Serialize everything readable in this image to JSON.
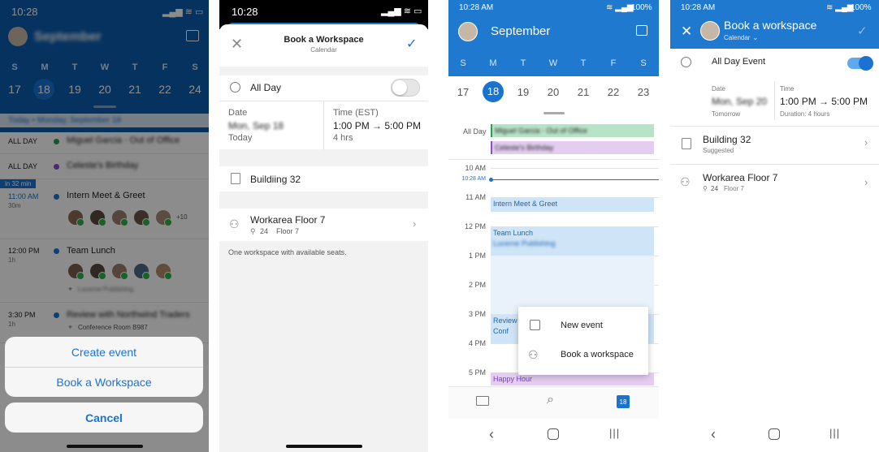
{
  "panel1": {
    "status_time": "10:28",
    "header_title": "September",
    "weekdays": [
      "S",
      "M",
      "T",
      "W",
      "T",
      "F",
      "S"
    ],
    "dates": [
      "17",
      "18",
      "19",
      "20",
      "21",
      "22",
      "24"
    ],
    "selected_date": "18",
    "today_strip": "Today • Monday, September 18",
    "events": [
      {
        "time": "ALL DAY",
        "title": "Miguel Garcia - Out of Office",
        "color": "#2e9b52"
      },
      {
        "time": "ALL DAY",
        "title": "Celeste's Birthday",
        "color": "#8a4fc2"
      },
      {
        "badge": "in 32 min",
        "time": "11:00 AM",
        "sub": "30m",
        "title": "Intern Meet & Greet",
        "color": "#1873d3",
        "more": "+10"
      },
      {
        "time": "12:00 PM",
        "sub": "1h",
        "title": "Team Lunch",
        "location": "Lucerne Publishing",
        "color": "#1873d3"
      },
      {
        "time": "3:30 PM",
        "sub": "1h",
        "title": "Review with Northwind Traders",
        "location": "Conference Room B987",
        "color": "#1873d3"
      }
    ],
    "sheet": {
      "create_event": "Create event",
      "book_workspace": "Book a Workspace",
      "cancel": "Cancel"
    }
  },
  "panel2": {
    "status_time": "10:28",
    "title": "Book a Workspace",
    "subtitle": "Calendar",
    "all_day_label": "All Day",
    "date_label": "Date",
    "date_value": "Mon, Sep 18",
    "date_sub": "Today",
    "time_label": "Time (EST)",
    "time_value": "1:00 PM → 5:00 PM",
    "time_sub": "4 hrs",
    "building": "Buildiing 32",
    "workarea": "Workarea Floor 7",
    "seats": "24",
    "floor": "Floor 7",
    "note": "One workspace with available seats."
  },
  "panel3": {
    "status_time": "10:28 AM",
    "battery": "100%",
    "month": "September",
    "weekdays": [
      "S",
      "M",
      "T",
      "W",
      "T",
      "F",
      "S"
    ],
    "dates": [
      "17",
      "18",
      "19",
      "20",
      "21",
      "22",
      "23"
    ],
    "selected_date": "18",
    "all_day_label": "All Day",
    "allday_events": [
      {
        "title": "Miguel Garcia - Out of Office",
        "color": "#b9e3c6"
      },
      {
        "title": "Celeste's Birthday",
        "color": "#e3cdf1"
      }
    ],
    "hours": [
      "10 AM",
      "11 AM",
      "12 PM",
      "1 PM",
      "2 PM",
      "3 PM",
      "4 PM",
      "5 PM"
    ],
    "now_label": "10:28 AM",
    "events": [
      {
        "title": "Intern Meet & Greet"
      },
      {
        "title": "Team Lunch",
        "location": "Lucerne Publishing"
      },
      {
        "title": "Review w",
        "location": "Conf"
      },
      {
        "title": "Happy Hour"
      }
    ],
    "popup": {
      "new_event": "New event",
      "book_workspace": "Book a workspace"
    },
    "tab_calendar_date": "18"
  },
  "panel4": {
    "status_time": "10:28 AM",
    "battery": "100%",
    "title": "Book a workspace",
    "subtitle": "Calendar",
    "all_day_label": "All Day Event",
    "date_label": "Date",
    "date_value": "Mon, Sep 20",
    "date_sub": "Tomorrow",
    "time_label": "Time",
    "time_value": "1:00 PM → 5:00 PM",
    "time_sub": "Duration: 4 hours",
    "building": "Building 32",
    "building_sub": "Suggested",
    "workarea": "Workarea Floor 7",
    "seats": "24",
    "floor": "Floor 7"
  }
}
